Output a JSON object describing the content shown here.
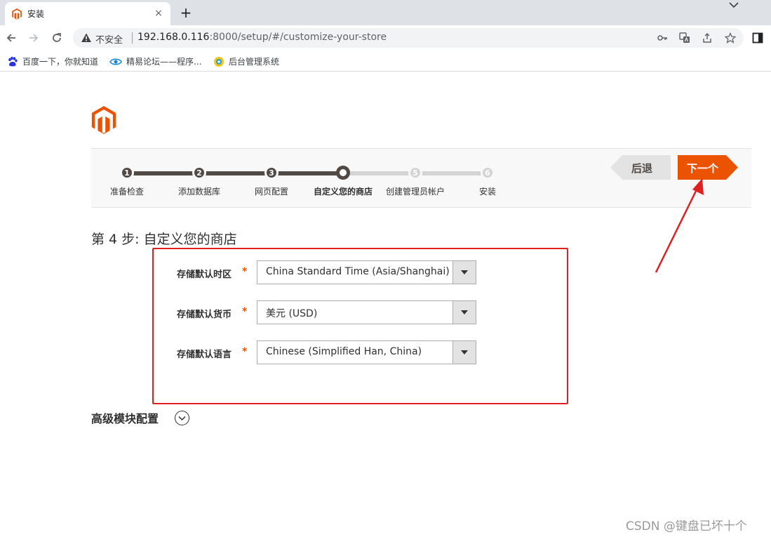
{
  "browser": {
    "tab_title": "安装",
    "new_tab_symbol": "+",
    "close_symbol": "×",
    "security_label": "不安全",
    "url_host": "192.168.0.116",
    "url_rest": ":8000/setup/#/customize-your-store",
    "bookmarks": [
      "百度一下，你就知道",
      "精易论坛——程序...",
      "后台管理系统"
    ]
  },
  "steps": [
    {
      "number": "1",
      "label": "准备检查",
      "state": "done"
    },
    {
      "number": "2",
      "label": "添加数据库",
      "state": "done"
    },
    {
      "number": "3",
      "label": "网页配置",
      "state": "done"
    },
    {
      "number": "4",
      "label": "自定义您的商店",
      "state": "current"
    },
    {
      "number": "5",
      "label": "创建管理员帐户",
      "state": "todo"
    },
    {
      "number": "6",
      "label": "安装",
      "state": "todo"
    }
  ],
  "nav": {
    "back_label": "后退",
    "next_label": "下一个"
  },
  "page": {
    "heading": "第 4 步:  自定义您的商店",
    "required_mark": "*",
    "fields": [
      {
        "label": "存储默认时区",
        "value": "China Standard Time (Asia/Shanghai)"
      },
      {
        "label": "存储默认货币",
        "value": "美元 (USD)"
      },
      {
        "label": "存储默认语言",
        "value": "Chinese (Simplified Han, China)"
      }
    ],
    "advanced_label": "高级模块配置"
  },
  "watermark": "CSDN @键盘已坏十个",
  "colors": {
    "accent": "#eb5202",
    "annotation": "#e02020",
    "progress": "#514943"
  }
}
